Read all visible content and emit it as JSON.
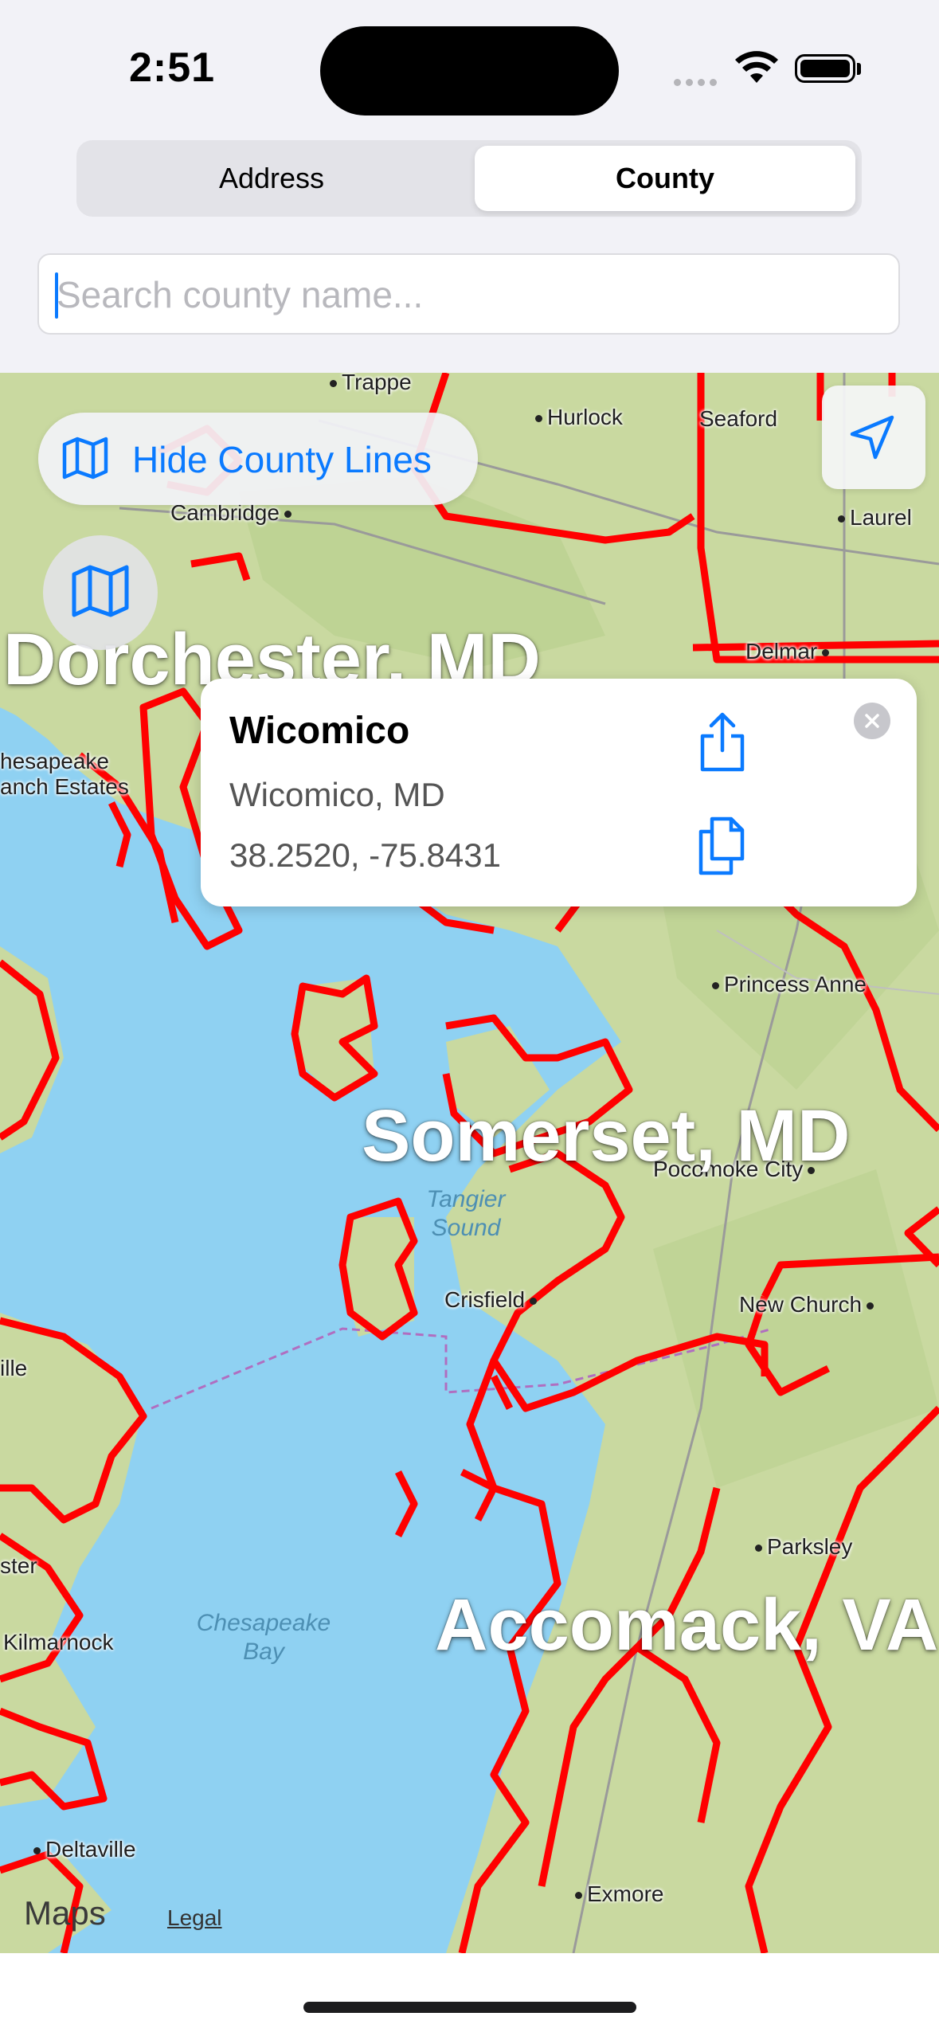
{
  "status_bar": {
    "time": "2:51"
  },
  "segmented": {
    "address_label": "Address",
    "county_label": "County",
    "selected": "County"
  },
  "search": {
    "placeholder": "Search county name...",
    "value": ""
  },
  "map": {
    "hide_lines_label": "Hide County Lines",
    "county_labels": [
      "Dorchester, MD",
      "Somerset, MD",
      "Accomack, VA"
    ],
    "places": [
      "Trappe",
      "Hurlock",
      "Seaford",
      "Cambridge",
      "Laurel",
      "Delmar",
      "hesapeake",
      "anch Estates",
      "Princess Anne",
      "Pocomoke City",
      "Crisfield",
      "New Church",
      "ille",
      "Parksley",
      "ster",
      "Kilmarnock",
      "Deltaville",
      "Exmore"
    ],
    "water": [
      "Tangier Sound",
      "Chesapeake Bay"
    ],
    "attribution": {
      "logo": "Maps",
      "legal": "Legal"
    },
    "icons": {
      "map": "map-icon",
      "locate": "location-arrow-icon"
    }
  },
  "popup": {
    "title": "Wicomico",
    "subtitle": "Wicomico, MD",
    "coordinates": "38.2520, -75.8431",
    "icons": {
      "share": "share-icon",
      "copy": "copy-icon",
      "close": "close-icon"
    }
  },
  "colors": {
    "accent": "#0a7aff",
    "county_line": "#ff0000",
    "land": "#c9d9a0",
    "water": "#8fd1f2"
  }
}
